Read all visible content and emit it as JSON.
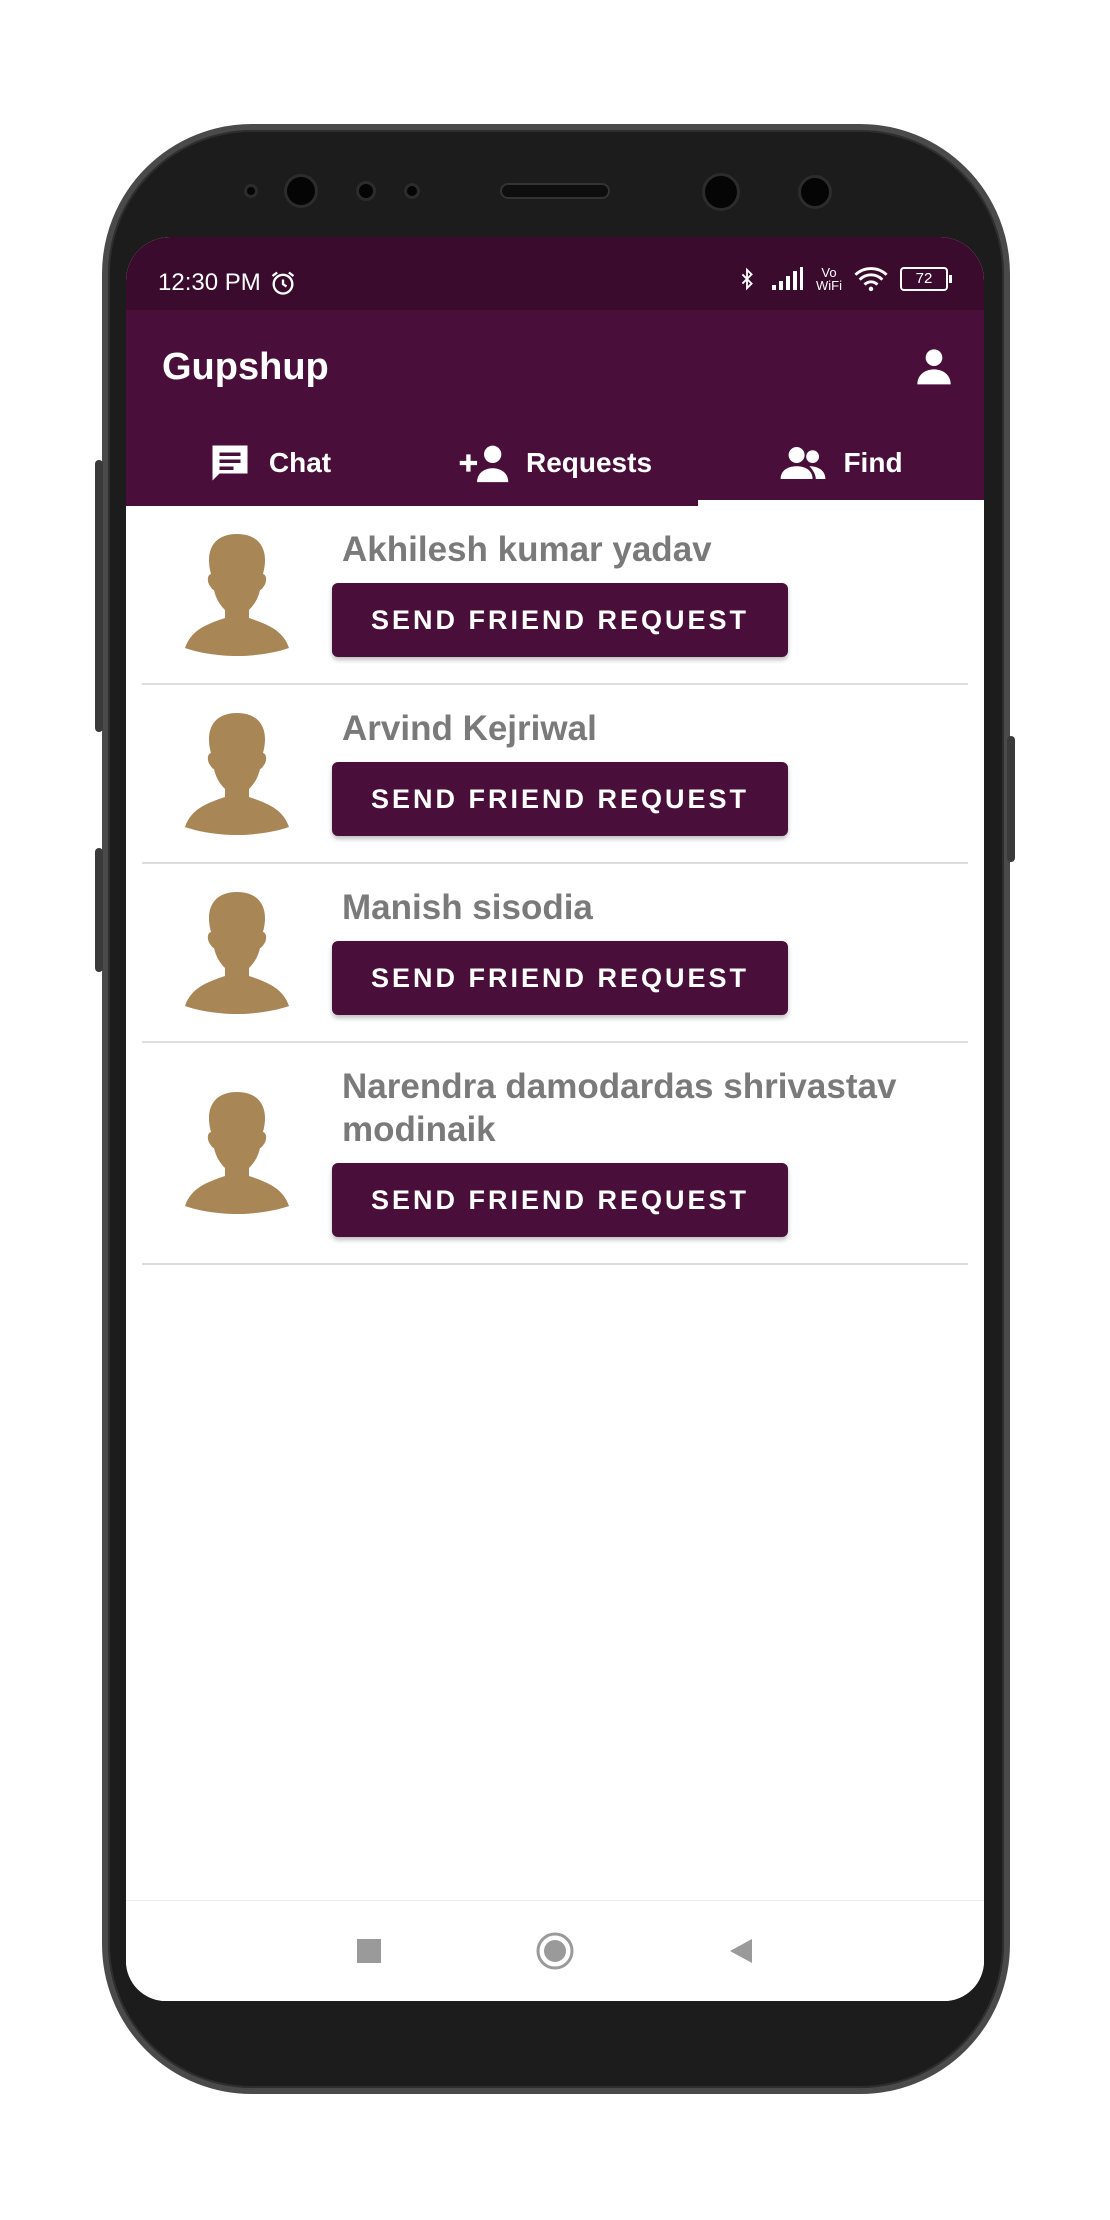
{
  "status_bar": {
    "time": "12:30 PM",
    "vowifi_top": "Vo",
    "vowifi_bottom": "WiFi",
    "battery": "72"
  },
  "app_bar": {
    "title": "Gupshup"
  },
  "tabs": [
    {
      "label": "Chat",
      "icon": "chat-icon",
      "active": false
    },
    {
      "label": "Requests",
      "icon": "add-person-icon",
      "active": false
    },
    {
      "label": "Find",
      "icon": "people-icon",
      "active": true
    }
  ],
  "users": [
    {
      "name": "Akhilesh kumar yadav",
      "button": "SEND FRIEND REQUEST"
    },
    {
      "name": "Arvind Kejriwal",
      "button": "SEND FRIEND REQUEST"
    },
    {
      "name": "Manish sisodia",
      "button": "SEND FRIEND REQUEST"
    },
    {
      "name": "Narendra damodardas shrivastav modinaik",
      "button": "SEND FRIEND REQUEST"
    }
  ],
  "colors": {
    "primary": "#490f3a",
    "status_bar": "#3b0b2d",
    "avatar": "#a88655",
    "name_text": "#7a7a7a"
  }
}
